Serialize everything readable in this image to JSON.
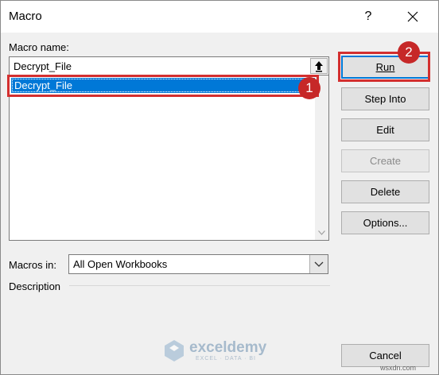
{
  "window": {
    "title": "Macro",
    "help_label": "?",
    "close_label": "✕"
  },
  "macro_name": {
    "label": "Macro name:",
    "value": "Decrypt_File"
  },
  "macro_list": {
    "items": [
      "Decrypt_File"
    ],
    "selected_index": 0
  },
  "buttons": {
    "run": "Run",
    "step_into": "Step Into",
    "edit": "Edit",
    "create": "Create",
    "delete": "Delete",
    "options": "Options...",
    "cancel": "Cancel"
  },
  "macros_in": {
    "label": "Macros in:",
    "value": "All Open Workbooks"
  },
  "description": {
    "label": "Description"
  },
  "annotations": {
    "badge_1": "1",
    "badge_2": "2",
    "highlight_color": "#d32f2f"
  },
  "watermark": {
    "name": "exceldemy",
    "tagline": "EXCEL · DATA · BI"
  },
  "footer": {
    "text": "wsxdn.com"
  },
  "icons": {
    "upload": "upload-arrow-icon",
    "close": "close-icon",
    "dropdown": "chevron-down-icon"
  }
}
